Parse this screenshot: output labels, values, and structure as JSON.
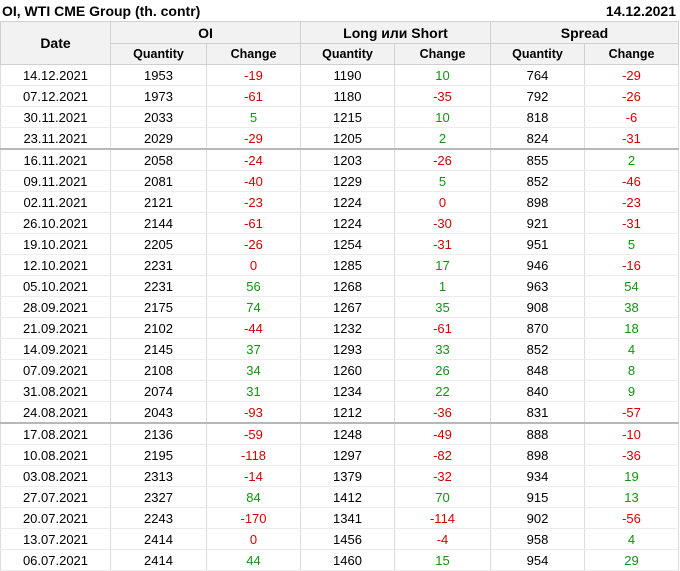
{
  "title": "OI, WTI CME Group (th. contr)",
  "report_date": "14.12.2021",
  "headers": {
    "date": "Date",
    "oi": "OI",
    "long_short": "Long или Short",
    "spread": "Spread",
    "quantity": "Quantity",
    "change": "Change"
  },
  "colors": {
    "negative": "#d40000",
    "positive": "#119411",
    "header_bg": "#f2f2f2"
  },
  "rows": [
    [
      "14.12.2021",
      "1953",
      "-19",
      "1190",
      "10",
      "764",
      "-29"
    ],
    [
      "07.12.2021",
      "1973",
      "-61",
      "1180",
      "-35",
      "792",
      "-26"
    ],
    [
      "30.11.2021",
      "2033",
      "5",
      "1215",
      "10",
      "818",
      "-6"
    ],
    [
      "23.11.2021",
      "2029",
      "-29",
      "1205",
      "2",
      "824",
      "-31"
    ],
    [
      "16.11.2021",
      "2058",
      "-24",
      "1203",
      "-26",
      "855",
      "2"
    ],
    [
      "09.11.2021",
      "2081",
      "-40",
      "1229",
      "5",
      "852",
      "-46"
    ],
    [
      "02.11.2021",
      "2121",
      "-23",
      "1224",
      "0",
      "898",
      "-23"
    ],
    [
      "26.10.2021",
      "2144",
      "-61",
      "1224",
      "-30",
      "921",
      "-31"
    ],
    [
      "19.10.2021",
      "2205",
      "-26",
      "1254",
      "-31",
      "951",
      "5"
    ],
    [
      "12.10.2021",
      "2231",
      "0",
      "1285",
      "17",
      "946",
      "-16"
    ],
    [
      "05.10.2021",
      "2231",
      "56",
      "1268",
      "1",
      "963",
      "54"
    ],
    [
      "28.09.2021",
      "2175",
      "74",
      "1267",
      "35",
      "908",
      "38"
    ],
    [
      "21.09.2021",
      "2102",
      "-44",
      "1232",
      "-61",
      "870",
      "18"
    ],
    [
      "14.09.2021",
      "2145",
      "37",
      "1293",
      "33",
      "852",
      "4"
    ],
    [
      "07.09.2021",
      "2108",
      "34",
      "1260",
      "26",
      "848",
      "8"
    ],
    [
      "31.08.2021",
      "2074",
      "31",
      "1234",
      "22",
      "840",
      "9"
    ],
    [
      "24.08.2021",
      "2043",
      "-93",
      "1212",
      "-36",
      "831",
      "-57"
    ],
    [
      "17.08.2021",
      "2136",
      "-59",
      "1248",
      "-49",
      "888",
      "-10"
    ],
    [
      "10.08.2021",
      "2195",
      "-118",
      "1297",
      "-82",
      "898",
      "-36"
    ],
    [
      "03.08.2021",
      "2313",
      "-14",
      "1379",
      "-32",
      "934",
      "19"
    ],
    [
      "27.07.2021",
      "2327",
      "84",
      "1412",
      "70",
      "915",
      "13"
    ],
    [
      "20.07.2021",
      "2243",
      "-170",
      "1341",
      "-114",
      "902",
      "-56"
    ],
    [
      "13.07.2021",
      "2414",
      "0",
      "1456",
      "-4",
      "958",
      "4"
    ],
    [
      "06.07.2021",
      "2414",
      "44",
      "1460",
      "15",
      "954",
      "29"
    ]
  ]
}
